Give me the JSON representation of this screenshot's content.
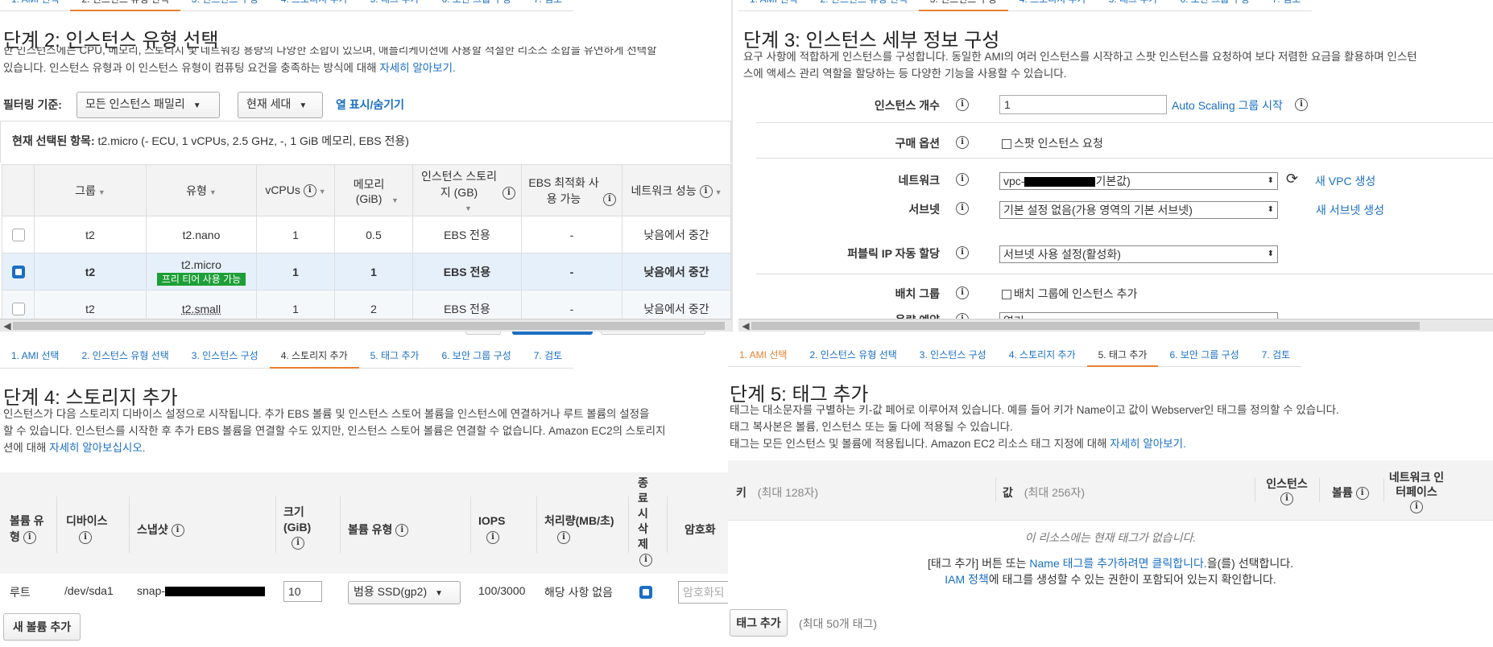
{
  "steps": [
    "1. AMI 선택",
    "2. 인스턴스 유형 선택",
    "3. 인스턴스 구성",
    "4. 스토리지 추가",
    "5. 태그 추가",
    "6. 보안 그룹 구성",
    "7. 검토"
  ],
  "step2": {
    "title": "단계 2: 인스턴스 유형 선택",
    "desc_line1": "한 인스턴스에는 CPU, 메모리, 스토리지 및 네트워킹 용량의 다양한 조합이 있으며, 애플리케이션에 사용할 적절한 리소스 조합을 유연하게 선택할",
    "desc_line2": "있습니다. 인스턴스 유형과 이 인스턴스 유형이 컴퓨팅 요건을 충족하는 방식에 대해",
    "desc_link": "자세히 알아보기.",
    "filter_label": "필터링 기준:",
    "filter_family": "모든 인스턴스 패밀리",
    "filter_gen": "현재 세대",
    "toggle_columns": "열 표시/숨기기",
    "current_label": "현재 선택된 항목:",
    "current_value": "t2.micro (- ECU, 1 vCPUs, 2.5 GHz, -, 1 GiB 메모리, EBS 전용)",
    "columns": [
      "그룹",
      "유형",
      "vCPUs",
      "메모리 (GiB)",
      "인스턴스 스토리지 (GB)",
      "EBS 최적화 사용 가능",
      "네트워크 성능"
    ],
    "rows": [
      {
        "group": "t2",
        "type": "t2.nano",
        "vcpu": "1",
        "mem": "0.5",
        "storage": "EBS 전용",
        "ebs": "-",
        "net": "낮음에서 중간",
        "badge": ""
      },
      {
        "group": "t2",
        "type": "t2.micro",
        "vcpu": "1",
        "mem": "1",
        "storage": "EBS 전용",
        "ebs": "-",
        "net": "낮음에서 중간",
        "badge": "프리 티어 사용 가능"
      },
      {
        "group": "t2",
        "type": "t2.small",
        "vcpu": "1",
        "mem": "2",
        "storage": "EBS 전용",
        "ebs": "-",
        "net": "낮음에서 중간",
        "badge": ""
      }
    ]
  },
  "step3": {
    "title": "단계 3: 인스턴스 세부 정보 구성",
    "desc_line1": "요구 사항에 적합하게 인스턴스를 구성합니다. 동일한 AMI의 여러 인스턴스를 시작하고 스팟 인스턴스를 요청하여 보다 저렴한 요금을 활용하며 인스턴",
    "desc_line2": "스에 액세스 관리 역할을 할당하는 등 다양한 기능을 사용할 수 있습니다.",
    "count_label": "인스턴스 개수",
    "count_value": "1",
    "asg_link": "Auto Scaling 그룹 시작",
    "purchase_label": "구매 옵션",
    "spot_label": "스팟 인스턴스 요청",
    "network_label": "네트워크",
    "network_prefix": "vpc-",
    "network_suffix": "기본값)",
    "new_vpc": "새 VPC 생성",
    "subnet_label": "서브넷",
    "subnet_value": "기본 설정 없음(가용 영역의 기본 서브넷)",
    "new_subnet": "새 서브넷 생성",
    "public_ip_label": "퍼블릭 IP 자동 할당",
    "public_ip_value": "서브넷 사용 설정(활성화)",
    "placement_label": "배치 그룹",
    "placement_check": "배치 그룹에 인스턴스 추가",
    "capacity_label": "용량 예약",
    "capacity_value": "열기"
  },
  "step4": {
    "title": "단계 4: 스토리지 추가",
    "desc_line1": "인스턴스가 다음 스토리지 디바이스 설정으로 시작됩니다. 추가 EBS 볼륨 및 인스턴스 스토어 볼륨을 인스턴스에 연결하거나 루트 볼륨의 설정을",
    "desc_line2": "할 수 있습니다. 인스턴스를 시작한 후 추가 EBS 볼륨을 연결할 수도 있지만, 인스턴스 스토어 볼륨은 연결할 수 없습니다. Amazon EC2의 스토리지",
    "desc_line3": "션에 대해",
    "desc_link": "자세히 알아보십시오.",
    "columns": [
      "볼륨 유형",
      "디바이스",
      "스냅샷",
      "크기 (GiB)",
      "볼륨 유형",
      "IOPS",
      "처리량(MB/초)",
      "종료 시 삭제",
      "암호화"
    ],
    "row": {
      "vol_type": "루트",
      "device": "/dev/sda1",
      "snapshot": "snap-",
      "size": "10",
      "volume": "범용 SSD(gp2)",
      "iops": "100/3000",
      "throughput": "해당 사항 없음",
      "encrypt_placeholder": "암호화되"
    },
    "add_volume": "새 볼륨 추가"
  },
  "step5": {
    "title": "단계 5: 태그 추가",
    "desc_line1": "태그는 대소문자를 구별하는 키-값 페어로 이루어져 있습니다. 예를 들어 키가 Name이고 값이 Webserver인 태그를 정의할 수 있습니다.",
    "desc_line2": "태그 복사본은 볼륨, 인스턴스 또는 둘 다에 적용될 수 있습니다.",
    "desc_line3": "태그는 모든 인스턴스 및 볼륨에 적용됩니다. Amazon EC2 리소스 태그 지정에 대해",
    "desc_link": "자세히 알아보기.",
    "col_key": "키",
    "col_key_hint": "(최대 128자)",
    "col_value": "값",
    "col_value_hint": "(최대 256자)",
    "col_instance": "인스턴스",
    "col_volume": "볼륨",
    "col_network": "네트워크 인터페이스",
    "empty": "이 리소스에는 현재 태그가 없습니다.",
    "hint_a": "[태그 추가] 버튼 또는",
    "hint_link": "Name 태그를 추가하려면 클릭합니다.",
    "hint_b": "을(를) 선택합니다.",
    "iam_link": "IAM 정책",
    "iam_text": "에 태그를 생성할 수 있는 권한이 포함되어 있는지 확인합니다.",
    "add_tag": "태그 추가",
    "max_tags": "(최대 50개 태그)"
  }
}
